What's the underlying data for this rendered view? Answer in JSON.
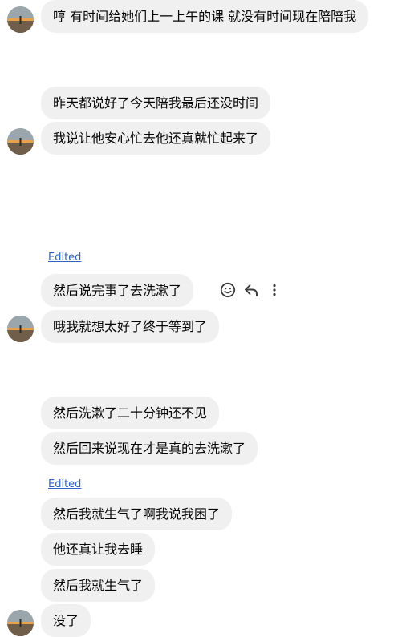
{
  "messages": [
    {
      "text": "哼 有时间给她们上一上午的课 就没有时间现在陪陪我"
    },
    {
      "text": "昨天都说好了今天陪我最后还没时间"
    },
    {
      "text": "我说让他安心忙去他还真就忙起来了"
    },
    {
      "text": "然后说完事了去洗漱了"
    },
    {
      "text": "哦我就想太好了终于等到了"
    },
    {
      "text": "然后洗漱了二十分钟还不见"
    },
    {
      "text": "然后回来说现在才是真的去洗漱了"
    },
    {
      "text": "然后我就生气了啊我说我困了"
    },
    {
      "text": "他还真让我去睡"
    },
    {
      "text": "然后我就生气了"
    },
    {
      "text": "没了"
    }
  ],
  "edited_label": "Edited",
  "actions": {
    "react_icon": "smiley-icon",
    "reply_icon": "reply-icon",
    "more_icon": "more-vertical-icon"
  },
  "colors": {
    "bubble_bg": "#f0f0f0",
    "text": "#050505",
    "edited_link": "#2d63c7"
  }
}
